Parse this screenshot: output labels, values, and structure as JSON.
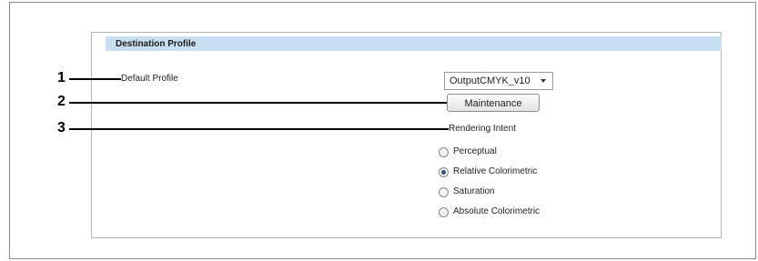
{
  "panel": {
    "title": "Destination Profile"
  },
  "callouts": [
    "1",
    "2",
    "3"
  ],
  "default_profile": {
    "label": "Default Profile",
    "selected_value": "OutputCMYK_v10"
  },
  "maintenance_button": {
    "label": "Maintenance"
  },
  "rendering_intent": {
    "label": "Rendering Intent",
    "options": [
      {
        "label": "Perceptual",
        "selected": false
      },
      {
        "label": "Relative Colorimetric",
        "selected": true
      },
      {
        "label": "Saturation",
        "selected": false
      },
      {
        "label": "Absolute Colorimetric",
        "selected": false
      }
    ]
  },
  "colors": {
    "header_background": "#c8dff1",
    "radio_selected": "#3a4f7a"
  },
  "icons": {
    "dropdown": "chevron-down-icon"
  }
}
